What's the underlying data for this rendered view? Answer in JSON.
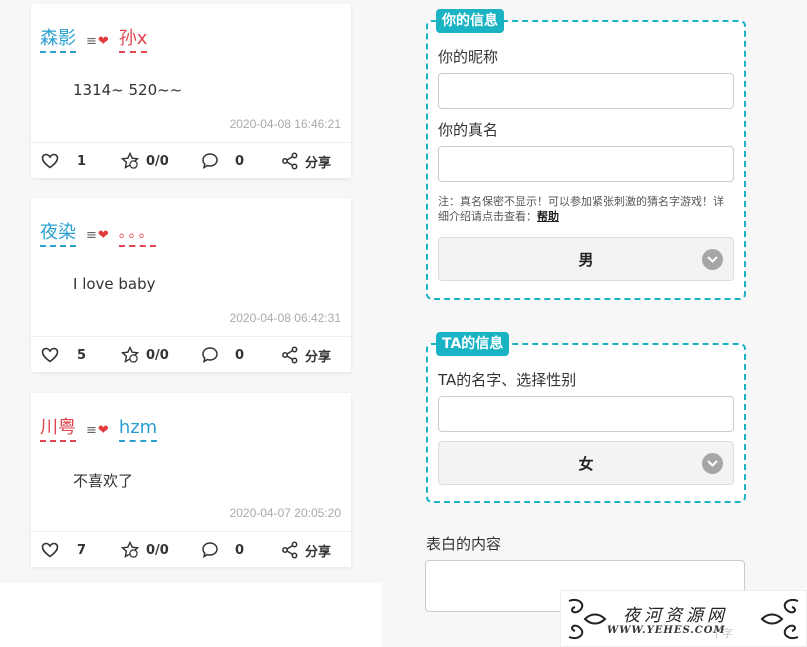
{
  "cards": [
    {
      "from": "森影",
      "to": "孙x",
      "message": "1314~ 520~~",
      "time": "2020-04-08 16:46:21",
      "likes": "1",
      "roses": "0/0",
      "comments": "0",
      "share": "分享"
    },
    {
      "from": "夜染",
      "to": "。。。",
      "message": "I love baby",
      "time": "2020-04-08 06:42:31",
      "likes": "5",
      "roses": "0/0",
      "comments": "0",
      "share": "分享"
    },
    {
      "from": "川粤",
      "to": "hzm",
      "message": "不喜欢了",
      "time": "2020-04-07 20:05:20",
      "likes": "7",
      "roses": "0/0",
      "comments": "0",
      "share": "分享"
    }
  ],
  "love_symbol": "≡",
  "form": {
    "your_info": {
      "legend": "你的信息",
      "nickname_label": "你的昵称",
      "realname_label": "你的真名",
      "note_text": "注：真名保密不显示！可以参加紧张刺激的猜名字游戏！详细介绍请点击查看：",
      "note_link": "帮助",
      "gender_selected": "男"
    },
    "ta_info": {
      "legend": "TA的信息",
      "name_label": "TA的名字、选择性别",
      "gender_selected": "女"
    },
    "content_label": "表白的内容"
  },
  "watermark": {
    "title": "夜河资源网",
    "url": "WWW.YEHES.COM",
    "ghost": "个字"
  },
  "colors": {
    "accent": "#1ab3c4",
    "name_blue": "#2a9fd0",
    "name_red": "#e0444e",
    "heart": "#e23b3b"
  }
}
